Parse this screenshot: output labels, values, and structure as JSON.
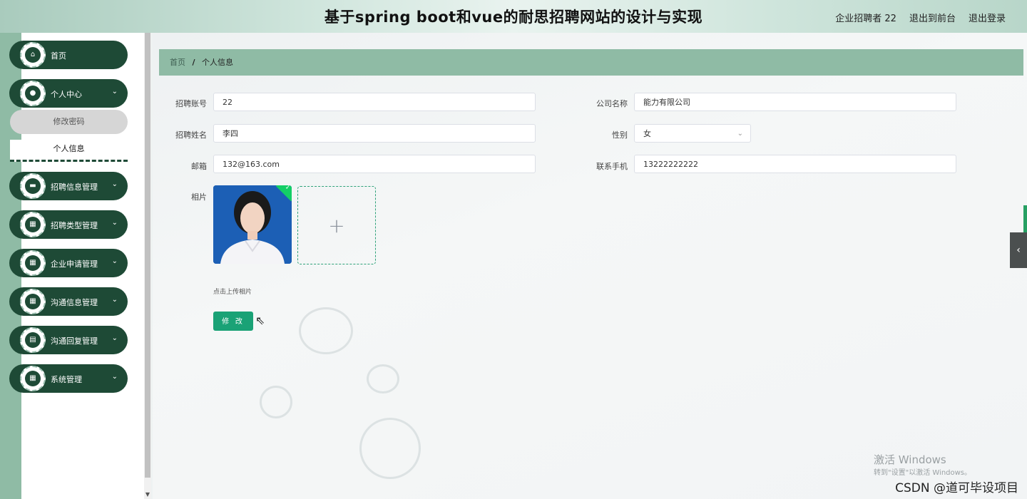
{
  "header": {
    "title": "基于spring boot和vue的耐思招聘网站的设计与实现",
    "user": "企业招聘者 22",
    "to_frontend": "退出到前台",
    "logout": "退出登录"
  },
  "sidebar": {
    "items": [
      {
        "label": "首页",
        "icon": "home-icon",
        "glyph": "⌂"
      },
      {
        "label": "个人中心",
        "icon": "user-icon",
        "glyph": "●"
      },
      {
        "label": "招聘信息管理",
        "icon": "briefcase-icon",
        "glyph": "▬"
      },
      {
        "label": "招聘类型管理",
        "icon": "grid-icon",
        "glyph": "▦"
      },
      {
        "label": "企业申请管理",
        "icon": "grid-icon",
        "glyph": "▦"
      },
      {
        "label": "沟通信息管理",
        "icon": "grid-icon",
        "glyph": "▦"
      },
      {
        "label": "沟通回复管理",
        "icon": "document-icon",
        "glyph": "▤"
      },
      {
        "label": "系统管理",
        "icon": "grid-icon",
        "glyph": "▦"
      }
    ],
    "sub_items": [
      "修改密码",
      "个人信息"
    ],
    "chevron": "⌄"
  },
  "breadcrumb": {
    "home": "首页",
    "separator": "/",
    "current": "个人信息"
  },
  "form": {
    "account_label": "招聘账号",
    "account_value": "22",
    "company_label": "公司名称",
    "company_value": "能力有限公司",
    "name_label": "招聘姓名",
    "name_value": "李四",
    "gender_label": "性别",
    "gender_value": "女",
    "email_label": "邮箱",
    "email_value": "132@163.com",
    "phone_label": "联系手机",
    "phone_value": "13222222222",
    "photo_label": "相片",
    "upload_plus": "+",
    "upload_hint": "点击上传相片",
    "submit_label": "修 改"
  },
  "overlay": {
    "win_line1": "激活 Windows",
    "win_line2": "转到\"设置\"以激活 Windows。",
    "csdn": "CSDN @道可毕设项目"
  },
  "colors": {
    "sidebar_green": "#1e4a36",
    "accent": "#1aa276",
    "breadcrumb_bg": "#8fbba5"
  }
}
